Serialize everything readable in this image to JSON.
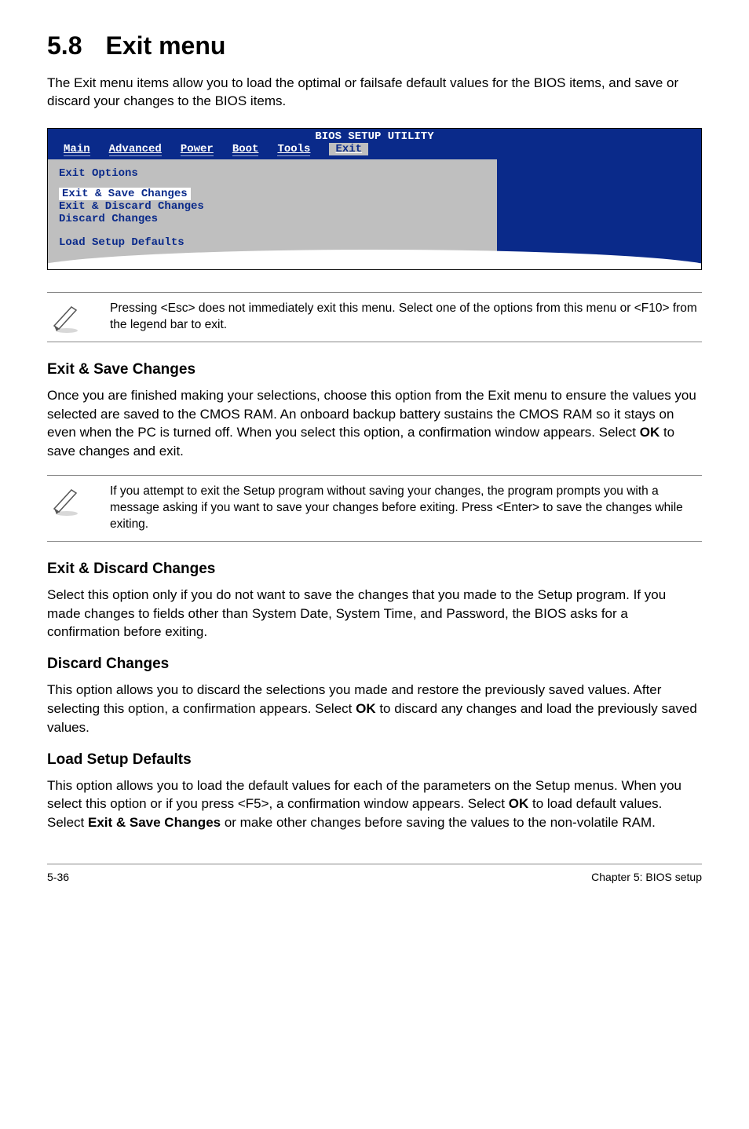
{
  "heading": {
    "number": "5.8",
    "title": "Exit menu"
  },
  "intro": "The Exit menu items allow you to load the optimal or failsafe default values for the BIOS items, and save or discard your changes to the BIOS items.",
  "bios": {
    "title": "BIOS SETUP UTILITY",
    "tabs": [
      "Main",
      "Advanced",
      "Power",
      "Boot",
      "Tools",
      "Exit"
    ],
    "options_title": "Exit Options",
    "items": {
      "selected": "Exit & Save Changes",
      "row2": "Exit & Discard Changes",
      "row3": "Discard Changes",
      "row4": "Load Setup Defaults"
    }
  },
  "note1": "Pressing <Esc> does not immediately exit this menu. Select one of the options from this menu or <F10> from the legend bar to exit.",
  "sections": {
    "s1": {
      "title": "Exit & Save Changes",
      "body_a": "Once you are finished making your selections, choose this option from the Exit menu to ensure the values you selected are saved to the CMOS RAM. An onboard backup battery sustains the CMOS RAM so it stays on even when the PC is turned off. When you select this option, a confirmation window appears. Select ",
      "body_bold": "OK",
      "body_b": " to save changes and exit."
    },
    "note2": " If you attempt to exit the Setup program without saving your changes, the program prompts you with a message asking if you want to save your changes before exiting. Press <Enter>  to save the  changes while exiting.",
    "s2": {
      "title": "Exit & Discard Changes",
      "body": "Select this option only if you do not want to save the changes that you  made to the Setup program. If you made changes to fields other than System Date, System Time, and Password, the BIOS asks for a confirmation before exiting."
    },
    "s3": {
      "title": "Discard Changes",
      "body_a": "This option allows you to discard the selections you made and restore the previously saved values. After selecting this option, a confirmation appears. Select ",
      "body_bold": "OK",
      "body_b": " to discard any changes and load the previously saved values."
    },
    "s4": {
      "title": "Load Setup Defaults",
      "body_a": "This option allows you to load the default values for each of the parameters on the Setup menus. When you select this option or if you press <F5>, a confirmation window appears. Select ",
      "body_bold1": "OK",
      "body_b": " to load default values. Select ",
      "body_bold2": "Exit & Save Changes",
      "body_c": " or make other changes before saving the values to the non-volatile RAM."
    }
  },
  "footer": {
    "left": "5-36",
    "right": "Chapter 5: BIOS setup"
  }
}
